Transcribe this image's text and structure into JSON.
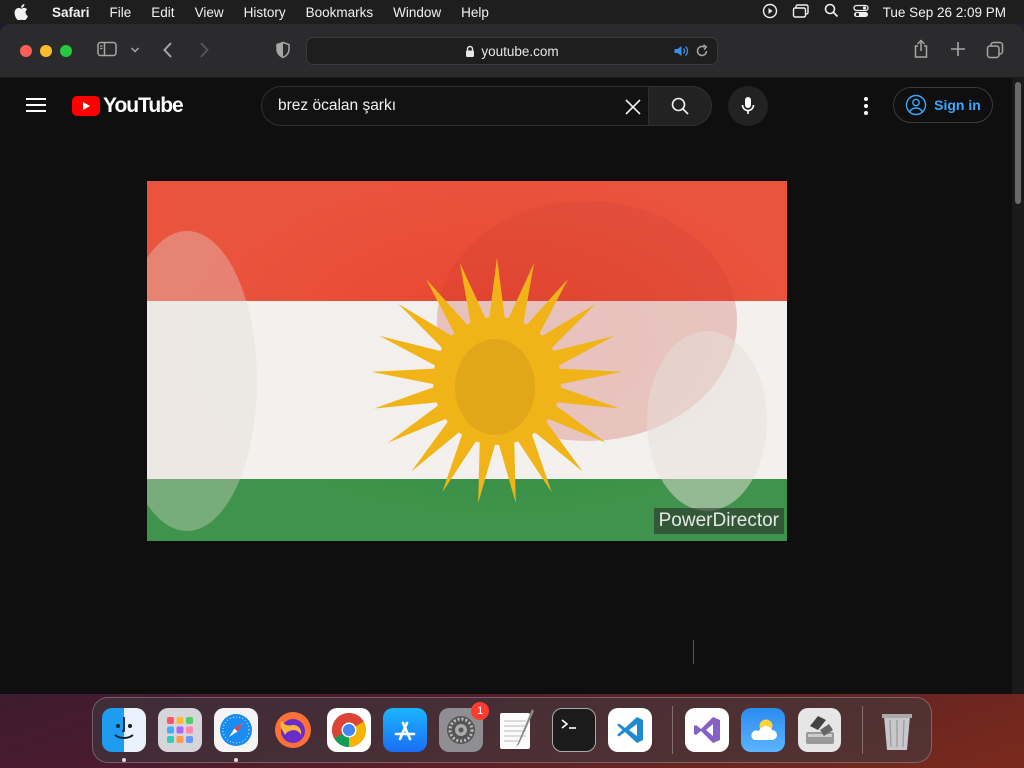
{
  "menubar": {
    "app_name": "Safari",
    "items": [
      "File",
      "Edit",
      "View",
      "History",
      "Bookmarks",
      "Window",
      "Help"
    ],
    "clock": "Tue Sep 26  2:09 PM",
    "status_icons": [
      "play-circle-icon",
      "screen-mirroring-icon",
      "spotlight-search-icon",
      "control-center-icon"
    ]
  },
  "browser": {
    "url": "youtube.com",
    "toolbar_icons": [
      "sidebar-icon",
      "chevron-down-icon",
      "back-icon",
      "forward-icon",
      "privacy-shield-icon",
      "share-icon",
      "new-tab-icon",
      "tab-overview-icon"
    ]
  },
  "youtube": {
    "logo_text": "YouTube",
    "search_value": "brez öcalan şarkı",
    "sign_in_label": "Sign in"
  },
  "video": {
    "watermark": "PowerDirector",
    "colors": {
      "red": "#e8452e",
      "white": "#f2efec",
      "green": "#2f8a3c",
      "sun": "#f0b418"
    }
  },
  "dock": {
    "apps": [
      {
        "name": "Finder",
        "running": true
      },
      {
        "name": "Launchpad",
        "running": false
      },
      {
        "name": "Safari",
        "running": true
      },
      {
        "name": "Firefox",
        "running": false
      },
      {
        "name": "Google Chrome",
        "running": false
      },
      {
        "name": "App Store",
        "running": false
      },
      {
        "name": "System Settings",
        "running": false,
        "badge": "1"
      },
      {
        "name": "TextEdit",
        "running": false
      },
      {
        "name": "Terminal",
        "running": false
      },
      {
        "name": "Visual Studio Code",
        "running": false
      },
      {
        "name": "Visual Studio",
        "running": false
      },
      {
        "name": "Weather",
        "running": false
      },
      {
        "name": "Boot Camp Assistant",
        "running": false
      },
      {
        "name": "Trash",
        "running": false
      }
    ]
  }
}
